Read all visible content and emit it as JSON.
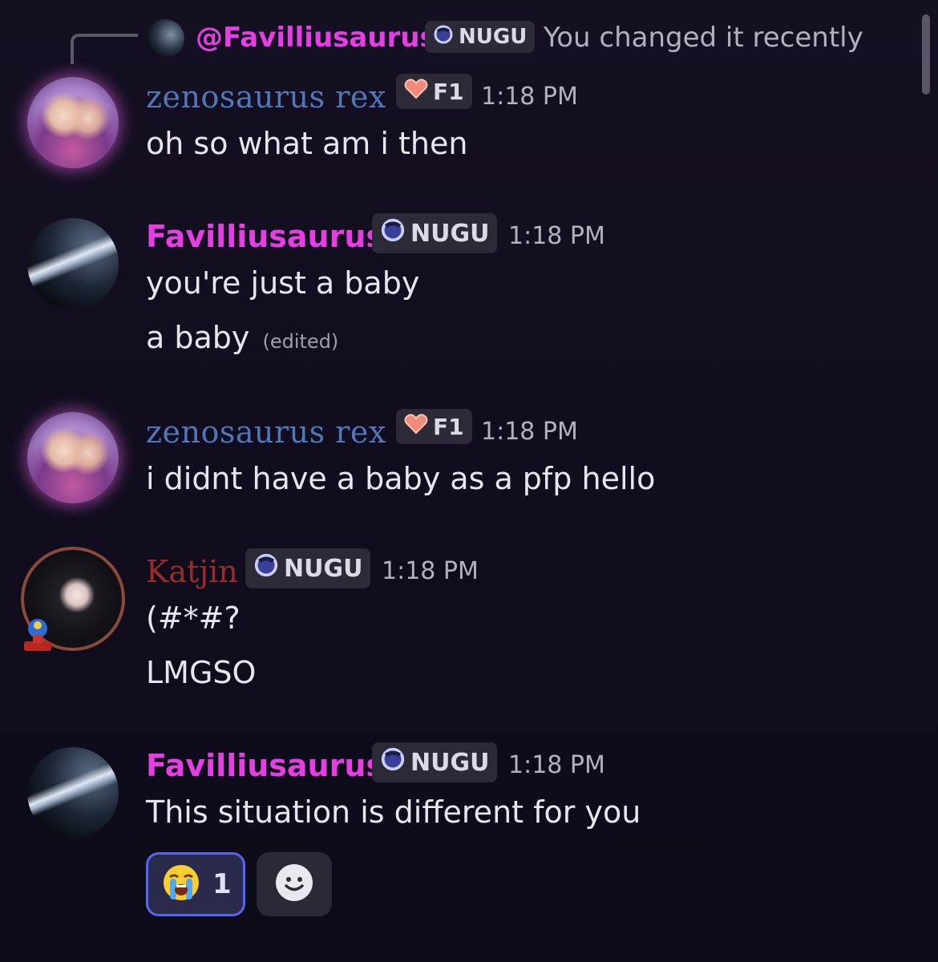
{
  "reply": {
    "author": "@Favilliusaurus",
    "badge": "NUGU",
    "text": "You changed it recently"
  },
  "messages": [
    {
      "author": "zenosaurus rex",
      "badge": "F1",
      "time": "1:18 PM",
      "lines": [
        "oh so what am i then"
      ]
    },
    {
      "author": "Favilliusaurus",
      "badge": "NUGU",
      "time": "1:18 PM",
      "lines": [
        "you're just a baby",
        "a baby"
      ],
      "edited": "(edited)"
    },
    {
      "author": "zenosaurus rex",
      "badge": "F1",
      "time": "1:18 PM",
      "lines": [
        "i didnt have a baby as a pfp hello"
      ]
    },
    {
      "author": "Katjin",
      "badge": "NUGU",
      "time": "1:18 PM",
      "lines": [
        "(#*#?",
        "LMGSO"
      ]
    },
    {
      "author": "Favilliusaurus",
      "badge": "NUGU",
      "time": "1:18 PM",
      "lines": [
        "This situation is different for you"
      ]
    }
  ],
  "reactions": [
    {
      "emoji": "😭",
      "emoji_name": "loudly-crying-face",
      "count": "1"
    }
  ],
  "add_reaction_icon": "smiley-face-icon",
  "colors": {
    "favi_name": "#e53fe3",
    "zeno_name": "#4f78b8",
    "katjin_name": "#9c2b2b",
    "reaction_border": "#5865f2"
  }
}
